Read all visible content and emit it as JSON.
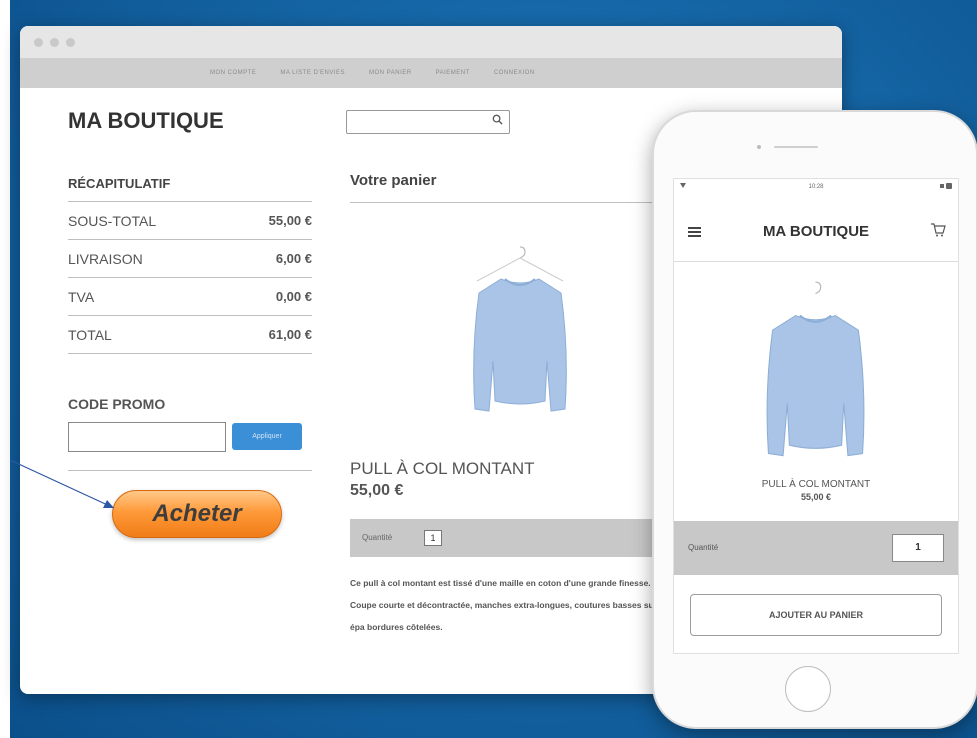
{
  "desktop": {
    "nav": [
      "MON COMPTE",
      "MA LISTE D'ENVIES",
      "MON PANIER",
      "PAIEMENT",
      "CONNEXION"
    ],
    "brand": "MA BOUTIQUE",
    "summary": {
      "title": "RÉCAPITULATIF",
      "rows": [
        {
          "label": "SOUS-TOTAL",
          "value": "55,00 €"
        },
        {
          "label": "LIVRAISON",
          "value": "6,00 €"
        },
        {
          "label": "TVA",
          "value": "0,00 €"
        },
        {
          "label": "TOTAL",
          "value": "61,00 €"
        }
      ]
    },
    "promo": {
      "label": "CODE PROMO",
      "input_value": "",
      "apply_label": "Appliquer"
    },
    "buy_label": "Acheter",
    "cart": {
      "title": "Votre panier",
      "product_name": "PULL À COL MONTANT",
      "product_price": "55,00 €",
      "quantity_label": "Quantité",
      "quantity_value": "1",
      "description": "Ce pull à col montant est tissé d'une maille en coton d'une grande finesse. Coupe courte et décontractée, manches extra-longues, coutures basses sur les épa bordures côtelées."
    }
  },
  "mobile": {
    "time": "10:28",
    "brand": "MA BOUTIQUE",
    "product_name": "PULL À COL MONTANT",
    "product_price": "55,00 €",
    "quantity_label": "Quantité",
    "quantity_value": "1",
    "add_to_cart_label": "AJOUTER AU PANIER"
  },
  "colors": {
    "backdrop": "#1668a8",
    "buy_button": "#ff9a3a",
    "apply_button": "#3b8fd6",
    "sweater": "#a9c4e6",
    "arrow": "#2b57a5"
  },
  "icons": [
    "search-icon",
    "hamburger-icon",
    "cart-icon",
    "signal-icon",
    "battery-icon"
  ]
}
